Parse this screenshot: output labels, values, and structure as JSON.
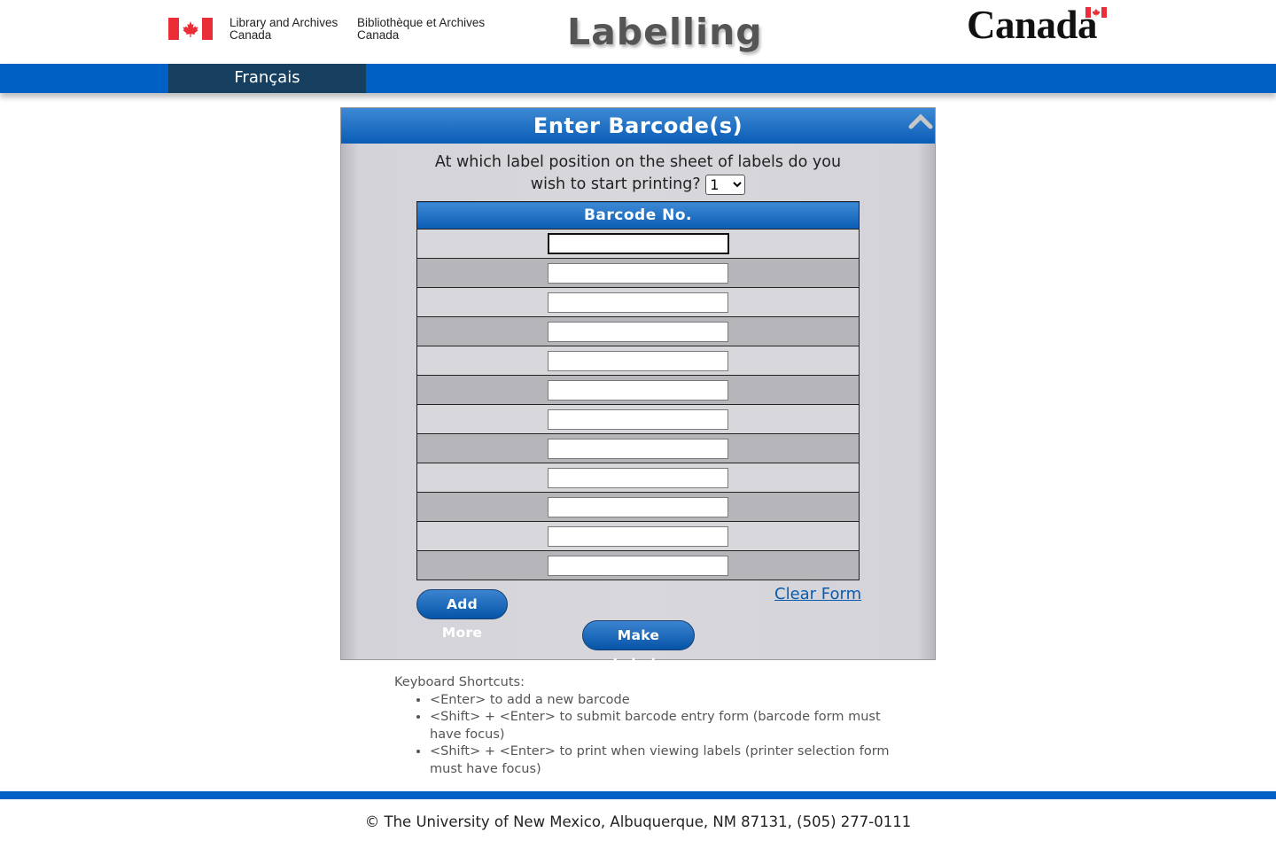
{
  "header": {
    "org_en_line1": "Library and Archives",
    "org_en_line2": "Canada",
    "org_fr_line1": "Bibliothèque et Archives",
    "org_fr_line2": "Canada",
    "app_title": "Labelling",
    "wordmark": "Canada"
  },
  "nav": {
    "language_link": "Français"
  },
  "panel": {
    "title": "Enter Barcode(s)",
    "question_line1": "At which label position on the sheet of labels do you",
    "question_line2": "wish to start printing?",
    "start_position": {
      "selected": "1",
      "options": [
        "1"
      ]
    },
    "table_header": "Barcode No.",
    "barcodes": [
      "",
      "",
      "",
      "",
      "",
      "",
      "",
      "",
      "",
      "",
      "",
      ""
    ],
    "add_more": "Add More",
    "clear_form": "Clear Form",
    "make_labels": "Make Labels"
  },
  "shortcuts": {
    "heading": "Keyboard Shortcuts:",
    "items": [
      "<Enter> to add a new barcode",
      "<Shift> + <Enter> to submit barcode entry form (barcode form must have focus)",
      "<Shift> + <Enter> to print when viewing labels (printer selection form must have focus)"
    ]
  },
  "footer": {
    "text": "© The University of New Mexico, Albuquerque, NM 87131, (505) 277-0111"
  },
  "colors": {
    "brand_blue": "#0060c4",
    "dark_nav": "#173f5f",
    "canada_red": "#eb2d37"
  }
}
